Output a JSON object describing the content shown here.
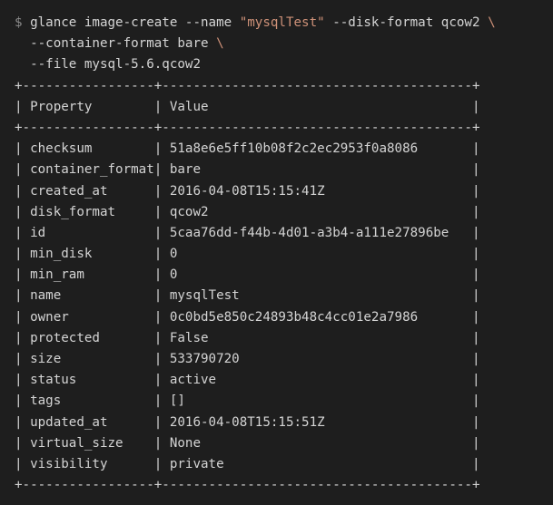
{
  "command": {
    "prompt": "$",
    "line1_prefix": "glance image-create --name ",
    "name_value": "\"mysqlTest\"",
    "line1_suffix": " --disk-format qcow2 ",
    "continuation": "\\",
    "line2": "  --container-format bare ",
    "line3": "  --file mysql-5.6.qcow2"
  },
  "table": {
    "border_line": "+-----------------+----------------------------------------+",
    "headers": {
      "property": "Property",
      "value": "Value"
    },
    "rows": [
      {
        "property": "checksum",
        "value": "51a8e6e5ff10b08f2c2ec2953f0a8086"
      },
      {
        "property": "container_format",
        "value": "bare"
      },
      {
        "property": "created_at",
        "value": "2016-04-08T15:15:41Z"
      },
      {
        "property": "disk_format",
        "value": "qcow2"
      },
      {
        "property": "id",
        "value": "5caa76dd-f44b-4d01-a3b4-a111e27896be"
      },
      {
        "property": "min_disk",
        "value": "0"
      },
      {
        "property": "min_ram",
        "value": "0"
      },
      {
        "property": "name",
        "value": "mysqlTest"
      },
      {
        "property": "owner",
        "value": "0c0bd5e850c24893b48c4cc01e2a7986"
      },
      {
        "property": "protected",
        "value": "False"
      },
      {
        "property": "size",
        "value": "533790720"
      },
      {
        "property": "status",
        "value": "active"
      },
      {
        "property": "tags",
        "value": "[]"
      },
      {
        "property": "updated_at",
        "value": "2016-04-08T15:15:51Z"
      },
      {
        "property": "virtual_size",
        "value": "None"
      },
      {
        "property": "visibility",
        "value": "private"
      }
    ]
  }
}
